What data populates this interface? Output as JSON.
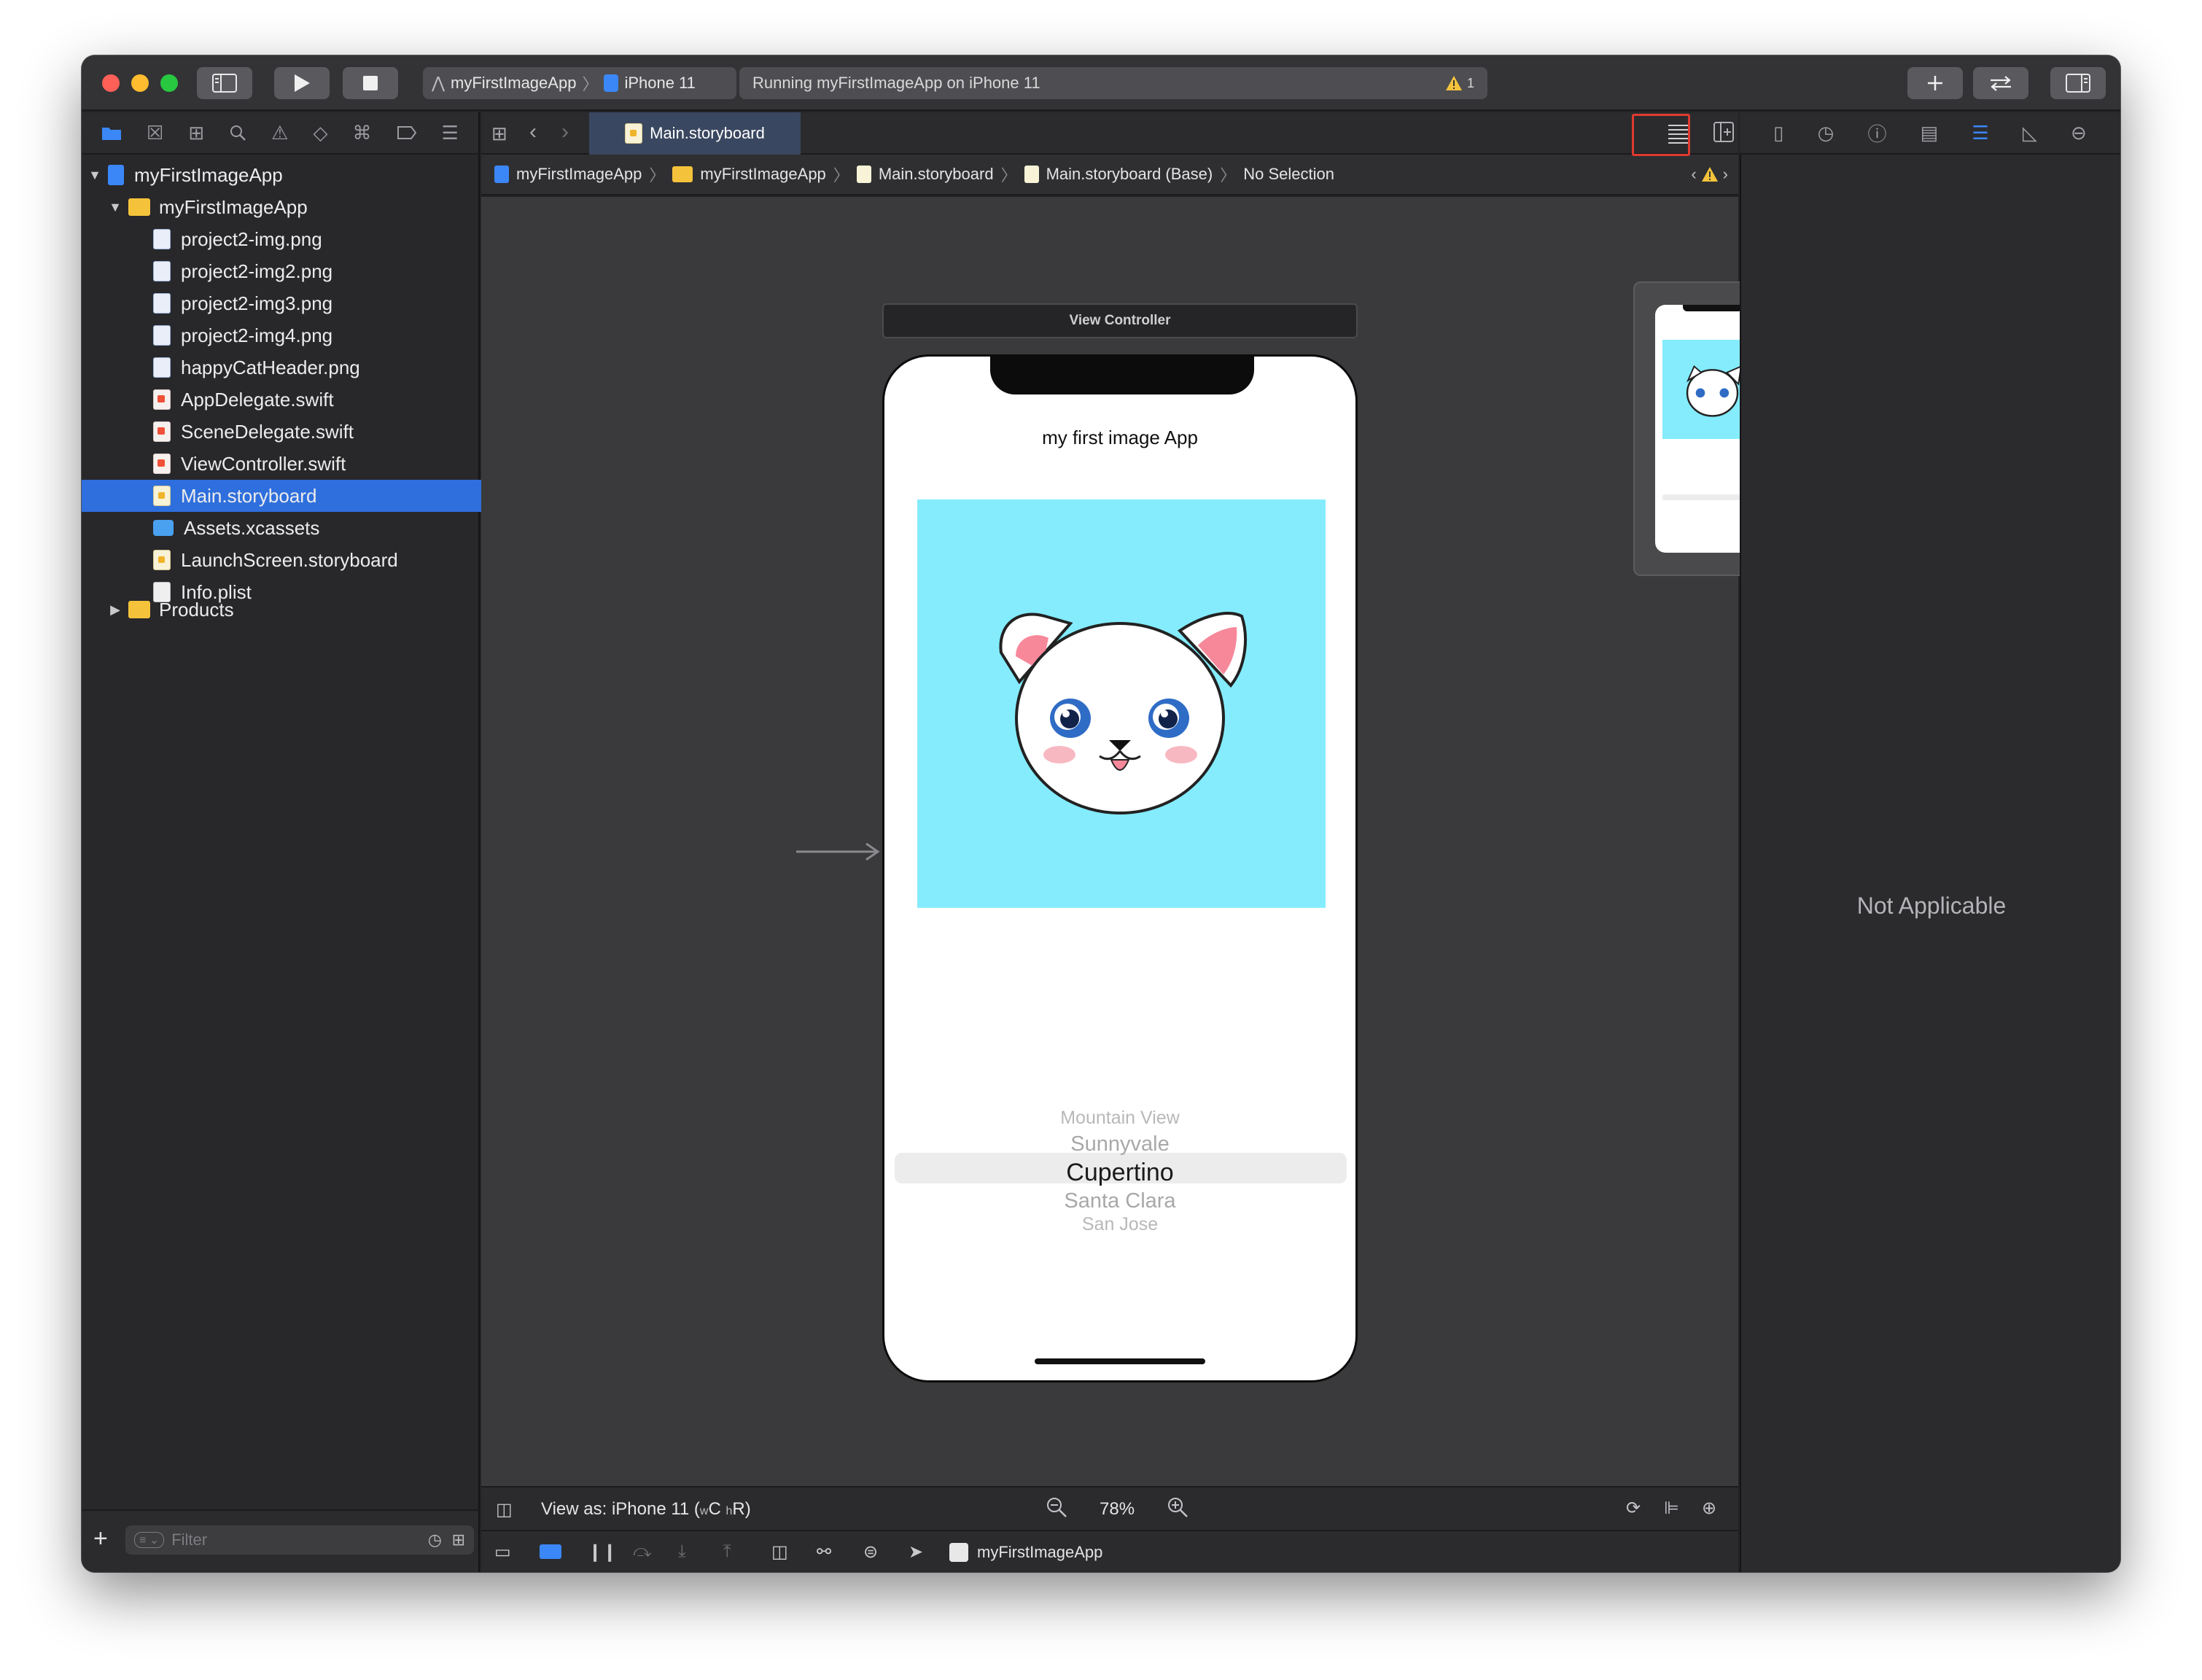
{
  "toolbar": {
    "scheme_app": "myFirstImageApp",
    "scheme_device": "iPhone 11",
    "status_text": "Running myFirstImageApp on iPhone 11",
    "warning_count": "1"
  },
  "editor": {
    "tab_label": "Main.storyboard",
    "breadcrumb": [
      "myFirstImageApp",
      "myFirstImageApp",
      "Main.storyboard",
      "Main.storyboard (Base)",
      "No Selection"
    ],
    "scene_title": "View Controller",
    "zoom": "78%",
    "view_as_prefix": "View as: iPhone 11 (",
    "view_as_w": "w",
    "view_as_c": "C",
    "view_as_h": "h",
    "view_as_r": "R)",
    "debug_target": "myFirstImageApp"
  },
  "app": {
    "title_label": "my first image App",
    "picker_items": [
      "Mountain View",
      "Sunnyvale",
      "Cupertino",
      "Santa Clara",
      "San Jose"
    ],
    "selected_index": 2,
    "image_bg_color": "#84ecfd"
  },
  "navigator": {
    "project": "myFirstImageApp",
    "group": "myFirstImageApp",
    "files": [
      {
        "name": "project2-img.png",
        "kind": "png"
      },
      {
        "name": "project2-img2.png",
        "kind": "png"
      },
      {
        "name": "project2-img3.png",
        "kind": "png"
      },
      {
        "name": "project2-img4.png",
        "kind": "png"
      },
      {
        "name": "happyCatHeader.png",
        "kind": "png"
      },
      {
        "name": "AppDelegate.swift",
        "kind": "swift"
      },
      {
        "name": "SceneDelegate.swift",
        "kind": "swift"
      },
      {
        "name": "ViewController.swift",
        "kind": "swift"
      },
      {
        "name": "Main.storyboard",
        "kind": "sb"
      },
      {
        "name": "Assets.xcassets",
        "kind": "assets"
      },
      {
        "name": "LaunchScreen.storyboard",
        "kind": "sb"
      },
      {
        "name": "Info.plist",
        "kind": "plist"
      }
    ],
    "selected_file": "Main.storyboard",
    "products": "Products",
    "filter_placeholder": "Filter"
  },
  "inspector": {
    "empty_text": "Not Applicable"
  },
  "colors": {
    "accent": "#3b87f7",
    "selection": "#2f6fdd",
    "highlight_box": "#e03a2f",
    "traffic_red": "#fe5f57",
    "traffic_yellow": "#febc2e",
    "traffic_green": "#28c840"
  }
}
